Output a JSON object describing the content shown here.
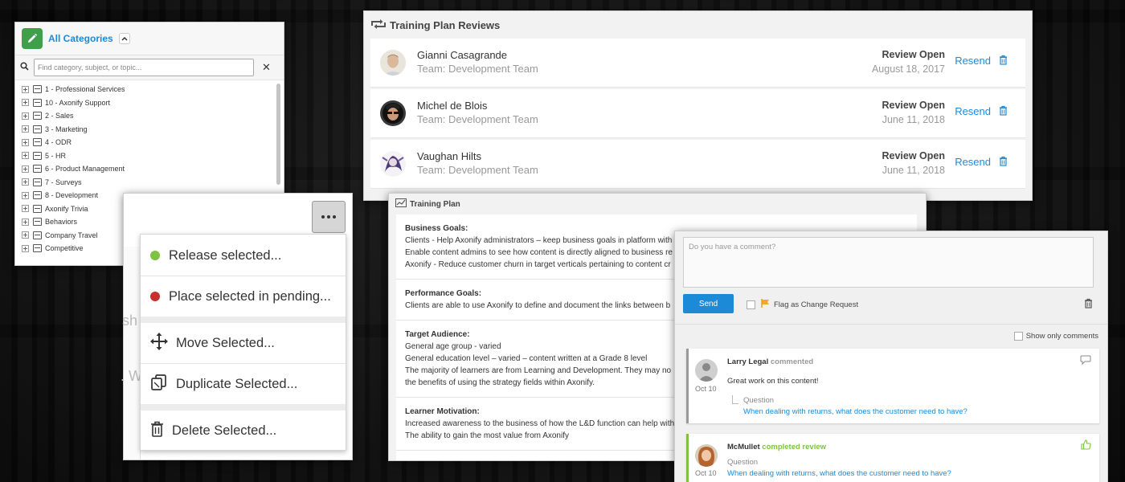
{
  "categories": {
    "title": "All Categories",
    "search_placeholder": "Find category, subject, or topic...",
    "items": [
      "1 - Professional Services",
      "10 - Axonify Support",
      "2 - Sales",
      "3 - Marketing",
      "4 - ODR",
      "5 - HR",
      "6 - Product Management",
      "7 - Surveys",
      "8 - Development",
      "Axonify Trivia",
      "Behaviors",
      "Company Travel",
      "Competitive"
    ]
  },
  "reviews": {
    "title": "Training Plan Reviews",
    "rows": [
      {
        "name": "Gianni Casagrande",
        "team": "Team: Development Team",
        "status": "Review Open",
        "date": "August 18, 2017",
        "action": "Resend"
      },
      {
        "name": "Michel de Blois",
        "team": "Team: Development Team",
        "status": "Review Open",
        "date": "June 11, 2018",
        "action": "Resend"
      },
      {
        "name": "Vaughan Hilts",
        "team": "Team: Development Team",
        "status": "Review Open",
        "date": "June 11, 2018",
        "action": "Resend"
      }
    ]
  },
  "plan": {
    "title": "Training Plan",
    "sections": [
      {
        "title": "Business Goals:",
        "lines": [
          "Clients - Help Axonify administrators – keep business goals in platform with",
          "Enable content admins to see how content is directly aligned to business re",
          "Axonify - Reduce customer churn in target verticals pertaining to content cr"
        ]
      },
      {
        "title": "Performance Goals:",
        "lines": [
          "Clients are able to use Axonify to define and document the links between b"
        ]
      },
      {
        "title": "Target Audience:",
        "lines": [
          "General age group - varied",
          "General education level – varied – content written at a Grade 8 level",
          "The majority of learners are from Learning and Development. They may no",
          "the benefits of using the strategy fields within Axonify."
        ]
      },
      {
        "title": "Learner Motivation:",
        "lines": [
          "Increased awareness to the business of how the L&D function can help with",
          "The ability to gain the most value from Axonify"
        ]
      }
    ]
  },
  "comments": {
    "placeholder": "Do you have a comment?",
    "send_label": "Send",
    "flag_label": "Flag as Change Request",
    "show_only_label": "Show only comments",
    "items": [
      {
        "author": "Larry Legal",
        "action": "commented",
        "text": "Great work on this content!",
        "question_label": "Question",
        "question": "When dealing with returns, what does the customer need to have?",
        "date": "Oct 10"
      },
      {
        "author": "McMullet",
        "action": "completed review",
        "question_label": "Question",
        "question": "When dealing with returns, what does the customer need to have?",
        "date": "Oct 10"
      }
    ]
  },
  "actions": {
    "ghost_text_1": "sh",
    "ghost_text_2": ". W",
    "items": [
      {
        "label": "Release selected...",
        "icon": "green-dot-icon"
      },
      {
        "label": "Place selected in pending...",
        "icon": "red-dot-icon"
      },
      {
        "label": "Move Selected...",
        "icon": "move-arrows-icon"
      },
      {
        "label": "Duplicate Selected...",
        "icon": "duplicate-icon"
      },
      {
        "label": "Delete Selected...",
        "icon": "trash-icon"
      }
    ]
  },
  "colors": {
    "accent": "#1d8ad8",
    "green": "#3f9f4a",
    "red": "#c9302c",
    "review_green": "#7dc242"
  }
}
